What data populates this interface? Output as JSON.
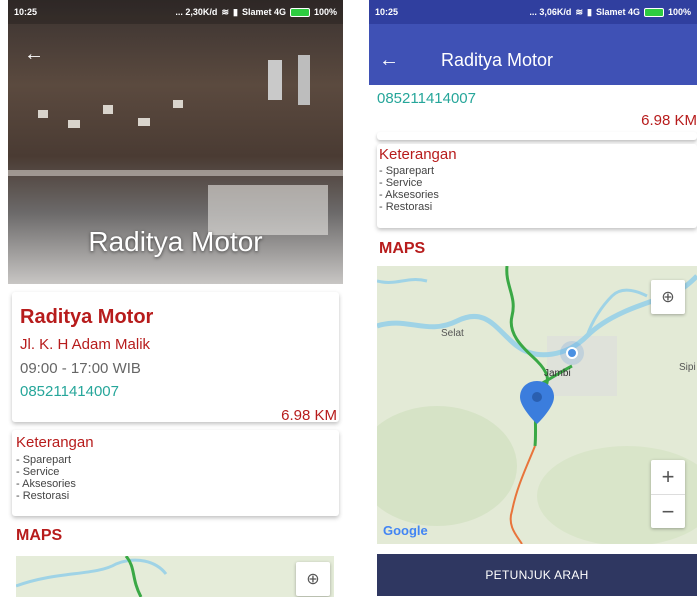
{
  "status_left": {
    "time": "10:25",
    "speed": "... 2,30K/d",
    "carrier": "Slamet 4G",
    "battery": "100%"
  },
  "status_right": {
    "time": "10:25",
    "speed": "... 3,06K/d",
    "carrier": "Slamet 4G",
    "battery": "100%"
  },
  "shop": {
    "name": "Raditya Motor",
    "address": "Jl. K. H Adam Malik",
    "hours": "09:00 - 17:00 WIB",
    "phone": "085211414007",
    "distance": "6.98 KM"
  },
  "keterangan": {
    "title": "Keterangan",
    "items": [
      "- Sparepart",
      "- Service",
      "- Aksesories",
      "- Restorasi"
    ]
  },
  "maps": {
    "title": "MAPS",
    "labels": {
      "selat": "Selat",
      "jambi": "Jambi",
      "sipin": "Sipi"
    },
    "google": "Google"
  },
  "app_bar": {
    "title": "Raditya Motor"
  },
  "cta": {
    "label": "PETUNJUK ARAH"
  },
  "colors": {
    "accent_red": "#b71c1c",
    "teal": "#26a69a",
    "indigo": "#3f51b5",
    "button": "#2f3761"
  }
}
